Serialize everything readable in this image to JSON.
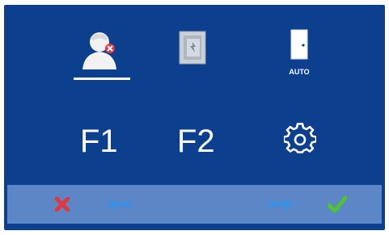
{
  "menu": {
    "f1_label": "F1",
    "f2_label": "F2",
    "auto_label": "AUTO",
    "icons": [
      "privacy-mode-icon",
      "door-release-icon",
      "auto-answer-door-icon",
      "settings-gear-icon"
    ]
  },
  "bottom_bar": {
    "buttons": [
      "cancel-icon",
      "arrow-left-icon",
      "arrow-right-icon",
      "confirm-check-icon"
    ]
  },
  "colors": {
    "background": "#0d3f8f",
    "bar": "#5d86c6",
    "cancel": "#e0383e",
    "confirm": "#4fc22e",
    "arrow": "#3e8fe0"
  }
}
